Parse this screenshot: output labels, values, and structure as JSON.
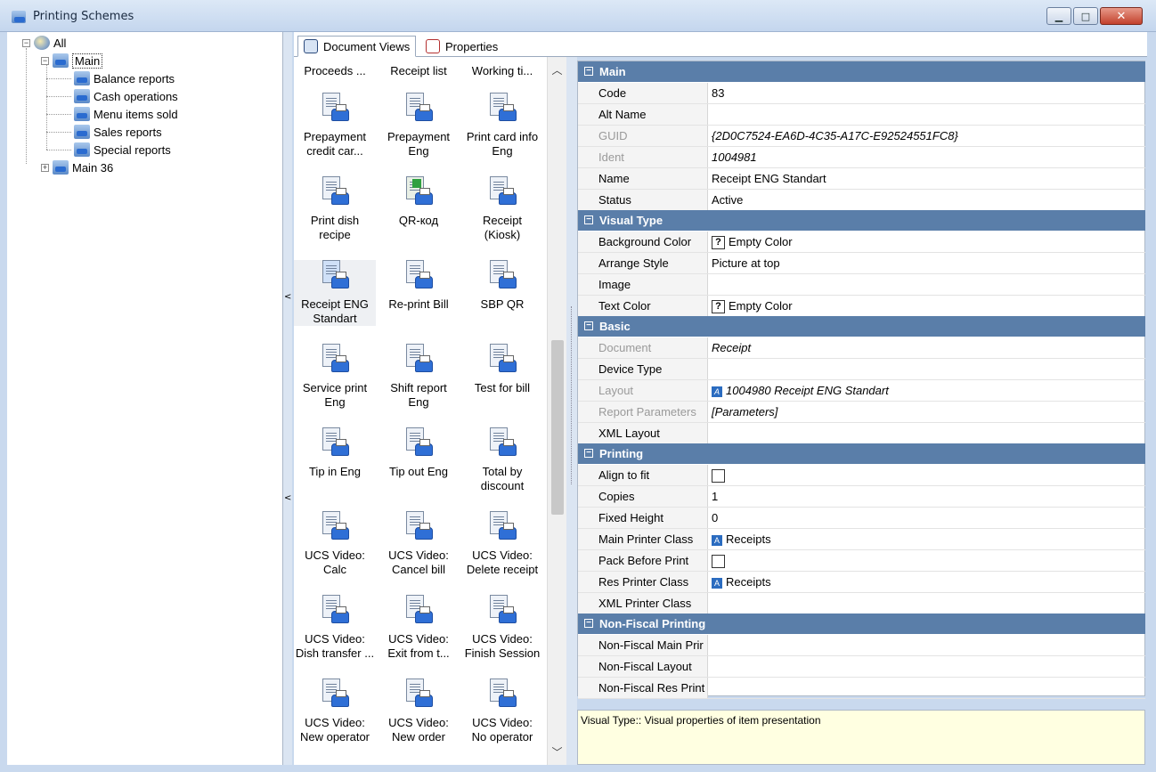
{
  "window": {
    "title": "Printing Schemes"
  },
  "tree": {
    "root": "All",
    "main": "Main",
    "children": [
      "Balance reports",
      "Cash operations",
      "Menu items sold",
      "Sales reports",
      "Special reports"
    ],
    "main36": "Main 36"
  },
  "tabs": {
    "document_views": "Document Views",
    "properties": "Properties"
  },
  "docs": {
    "top_row": [
      "Proceeds ...",
      "Receipt list",
      "Working ti..."
    ],
    "rows": [
      [
        "Prepayment\ncredit car...",
        "Prepayment\nEng",
        "Print card info\nEng"
      ],
      [
        "Print dish\nrecipe",
        "QR-код",
        "Receipt\n(Kiosk)"
      ],
      [
        "Receipt ENG\nStandart",
        "Re-print Bill",
        "SBP QR"
      ],
      [
        "Service print\nEng",
        "Shift report\nEng",
        "Test for bill"
      ],
      [
        "Tip in Eng",
        "Tip out Eng",
        "Total by\ndiscount"
      ],
      [
        "UCS Video:\nCalc",
        "UCS Video:\nCancel bill",
        "UCS Video:\nDelete receipt"
      ],
      [
        "UCS Video:\nDish transfer ...",
        "UCS Video:\nExit from t...",
        "UCS Video:\nFinish Session"
      ],
      [
        "UCS Video:\nNew operator",
        "UCS Video:\nNew order",
        "UCS Video:\nNo operator"
      ]
    ]
  },
  "props": {
    "main": {
      "label": "Main",
      "code_l": "Code",
      "code": "83",
      "alt_l": "Alt Name",
      "alt": "",
      "guid_l": "GUID",
      "guid": "{2D0C7524-EA6D-4C35-A17C-E92524551FC8}",
      "ident_l": "Ident",
      "ident": "1004981",
      "name_l": "Name",
      "name": "Receipt ENG Standart",
      "status_l": "Status",
      "status": "Active"
    },
    "visual": {
      "label": "Visual Type",
      "bg_l": "Background Color",
      "bg": "Empty Color",
      "arrange_l": "Arrange Style",
      "arrange": "Picture at top",
      "image_l": "Image",
      "text_l": "Text Color",
      "text": "Empty Color"
    },
    "basic": {
      "label": "Basic",
      "doc_l": "Document",
      "doc": "Receipt",
      "dev_l": "Device Type",
      "layout_l": "Layout",
      "layout": "1004980 Receipt ENG Standart",
      "repparam_l": "Report Parameters",
      "repparam": "[Parameters]",
      "xml_l": "XML Layout"
    },
    "printing": {
      "label": "Printing",
      "align_l": "Align to fit",
      "copies_l": "Copies",
      "copies": "1",
      "fixed_l": "Fixed Height",
      "fixed": "0",
      "mpc_l": "Main Printer Class",
      "mpc": "Receipts",
      "pack_l": "Pack Before Print",
      "rpc_l": "Res Printer Class",
      "rpc": "Receipts",
      "xpc_l": "XML Printer Class"
    },
    "nonfiscal": {
      "label": "Non-Fiscal Printing",
      "main_l": "Non-Fiscal Main Prir",
      "layout_l": "Non-Fiscal Layout",
      "res_l": "Non-Fiscal Res Print"
    }
  },
  "description": "Visual Type:: Visual properties of item presentation",
  "colors": {
    "category": "#5a7ea9",
    "description_bg": "#ffffe1",
    "close_button": "#c2412c"
  }
}
